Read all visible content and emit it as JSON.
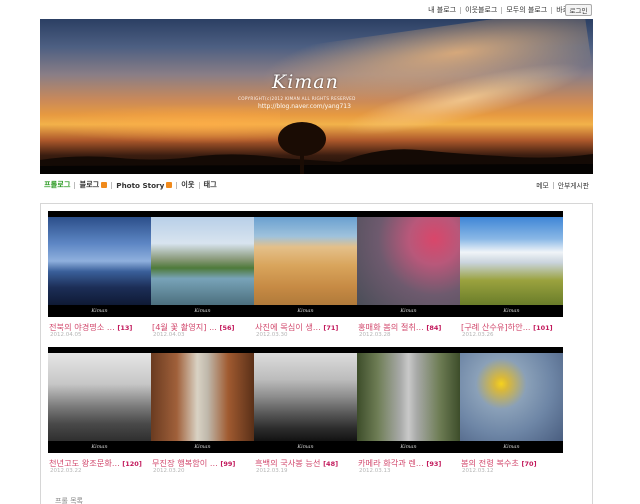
{
  "topnav": {
    "links": [
      "내 블로그",
      "이웃블로그",
      "모두의 블로그",
      "바로가기"
    ],
    "login": "로그인"
  },
  "banner": {
    "brand": "Kiman",
    "copyright": "COPYRIGHT(c)2012 KIMAN ALL RIGHTS RESERVED",
    "url": "http://blog.naver.com/yang713"
  },
  "menu": {
    "left": [
      "프롤로그",
      "블로그",
      "Photo Story",
      "이웃",
      "태그"
    ],
    "right": [
      "메모",
      "안부게시판"
    ]
  },
  "thumbs": [
    {
      "title": "전북의 야경명소 ...",
      "count": "[13]",
      "date": "2012.04.05"
    },
    {
      "title": "[4월 꽃 촬영지] ...",
      "count": "[56]",
      "date": "2012.04.03"
    },
    {
      "title": "사진에 목심이 생...",
      "count": "[71]",
      "date": "2012.03.30"
    },
    {
      "title": "홍매화 봄의 절취...",
      "count": "[84]",
      "date": "2012.03.28"
    },
    {
      "title": "[구례 산수유]하안...",
      "count": "[101]",
      "date": "2012.03.26"
    },
    {
      "title": "천년고도 왕조문화...",
      "count": "[120]",
      "date": "2012.03.22"
    },
    {
      "title": "무진장 행복함이 ...",
      "count": "[99]",
      "date": "2012.03.20"
    },
    {
      "title": "흑백의 국사봉 능선",
      "count": "[48]",
      "date": "2012.03.19"
    },
    {
      "title": "카메라 화각과 렌...",
      "count": "[93]",
      "date": "2012.03.13"
    },
    {
      "title": "봄의 전령 복수초",
      "count": "[70]",
      "date": "2012.03.12"
    }
  ],
  "footer": {
    "label": "프롤 목록"
  }
}
